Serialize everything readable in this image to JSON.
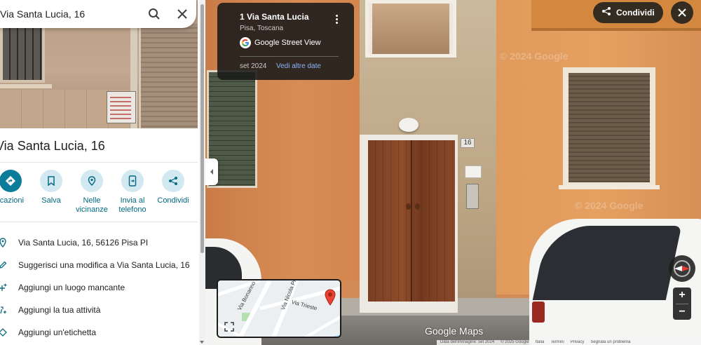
{
  "search": {
    "value": "Via Santa Lucia, 16"
  },
  "place": {
    "title": "Via Santa Lucia, 16"
  },
  "actions": [
    {
      "label": "Indicazioni",
      "icon": "directions-icon"
    },
    {
      "label": "Salva",
      "icon": "bookmark-icon"
    },
    {
      "label": "Nelle vicinanze",
      "label_line1": "Nelle",
      "label_line2": "vicinanze",
      "icon": "nearby-icon"
    },
    {
      "label": "Invia al telefono",
      "label_line1": "Invia al",
      "label_line2": "telefono",
      "icon": "send-to-phone-icon"
    },
    {
      "label": "Condividi",
      "icon": "share-icon"
    }
  ],
  "info_rows": [
    {
      "text": "Via Santa Lucia, 16, 56126 Pisa PI",
      "icon": "location-pin-icon"
    },
    {
      "text": "Suggerisci una modifica a Via Santa Lucia, 16",
      "icon": "edit-icon"
    },
    {
      "text": "Aggiungi un luogo mancante",
      "icon": "add-place-icon"
    },
    {
      "text": "Aggiungi la tua attività",
      "icon": "add-business-icon"
    },
    {
      "text": "Aggiungi un'etichetta",
      "icon": "label-icon"
    }
  ],
  "street_view": {
    "card_title": "1 Via Santa Lucia",
    "card_subtitle": "Pisa, Toscana",
    "provider": "Google Street View",
    "date": "set 2024",
    "more_dates": "Vedi altre date",
    "share_label": "Condividi",
    "house_number": "16",
    "brand": "Google Maps",
    "watermark": "© 2024 Google"
  },
  "minimap": {
    "streets": [
      "Via Bonanno Pisano",
      "Via Nicola Pisano",
      "Via Trieste"
    ]
  },
  "footer": [
    "Data dell'immagine: set 2024",
    "© 2025 Google",
    "Italia",
    "Termini",
    "Privacy",
    "Segnala un problema"
  ],
  "colors": {
    "accent": "#0b7c99",
    "action_bg": "#d2e9f1",
    "link": "#006880"
  }
}
